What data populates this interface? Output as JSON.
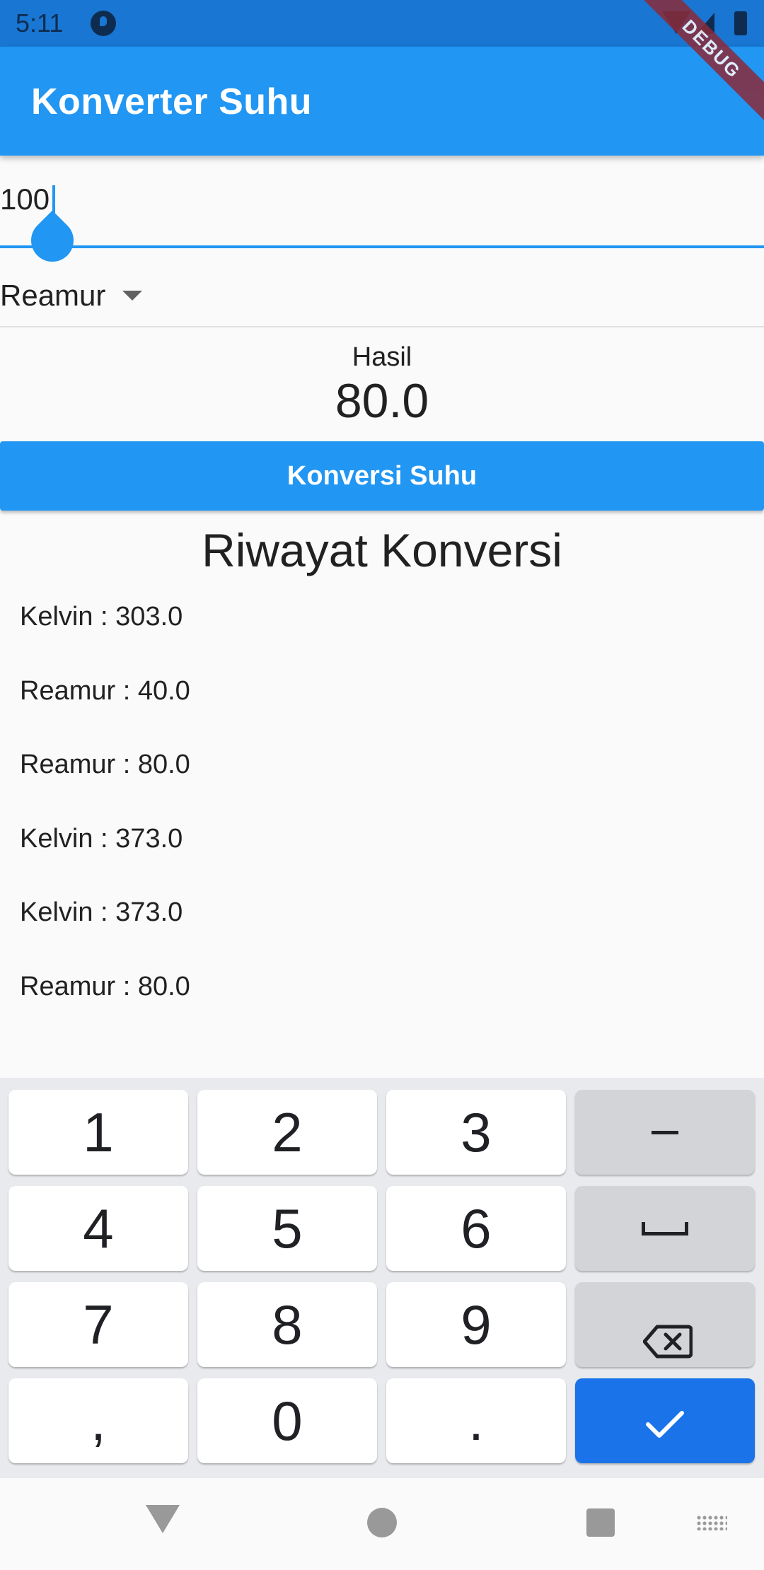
{
  "status": {
    "time": "5:11"
  },
  "app": {
    "title": "Konverter Suhu",
    "debug_label": "DEBUG"
  },
  "input": {
    "value": "100"
  },
  "dropdown": {
    "selected": "Reamur"
  },
  "result": {
    "label": "Hasil",
    "value": "80.0"
  },
  "button": {
    "label": "Konversi Suhu"
  },
  "history": {
    "title": "Riwayat Konversi",
    "items": [
      "Kelvin : 303.0",
      "Reamur : 40.0",
      "Reamur : 80.0",
      "Kelvin : 373.0",
      "Kelvin : 373.0",
      "Reamur : 80.0"
    ]
  },
  "keyboard": {
    "keys": [
      "1",
      "2",
      "3",
      "4",
      "5",
      "6",
      "7",
      "8",
      "9",
      ",",
      "0",
      "."
    ]
  },
  "colors": {
    "primary": "#2196f3",
    "status_bar": "#1976d2",
    "keyboard_accent": "#1a73e8"
  }
}
